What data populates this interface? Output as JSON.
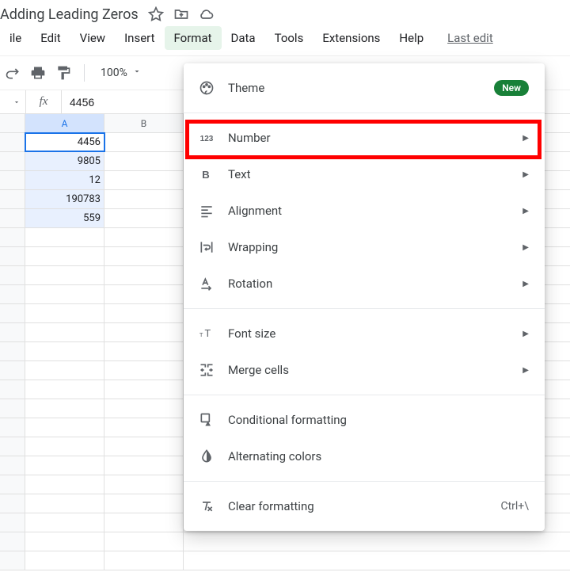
{
  "doc": {
    "title": "Adding Leading Zeros"
  },
  "menubar": {
    "file": "ile",
    "edit": "Edit",
    "view": "View",
    "insert": "Insert",
    "format": "Format",
    "data": "Data",
    "tools": "Tools",
    "extensions": "Extensions",
    "help": "Help",
    "last_edit": "Last edit"
  },
  "toolbar": {
    "zoom": "100%"
  },
  "formula": {
    "fx": "fx",
    "value": "4456"
  },
  "columns": [
    "A",
    "B"
  ],
  "cells": {
    "a1": "4456",
    "a2": "9805",
    "a3": "12",
    "a4": "190783",
    "a5": "559"
  },
  "dropdown": {
    "theme": "Theme",
    "new_badge": "New",
    "number": "Number",
    "text": "Text",
    "alignment": "Alignment",
    "wrapping": "Wrapping",
    "rotation": "Rotation",
    "font_size": "Font size",
    "merge": "Merge cells",
    "conditional": "Conditional formatting",
    "alternating": "Alternating colors",
    "clear": "Clear formatting",
    "clear_kbd": "Ctrl+\\"
  }
}
